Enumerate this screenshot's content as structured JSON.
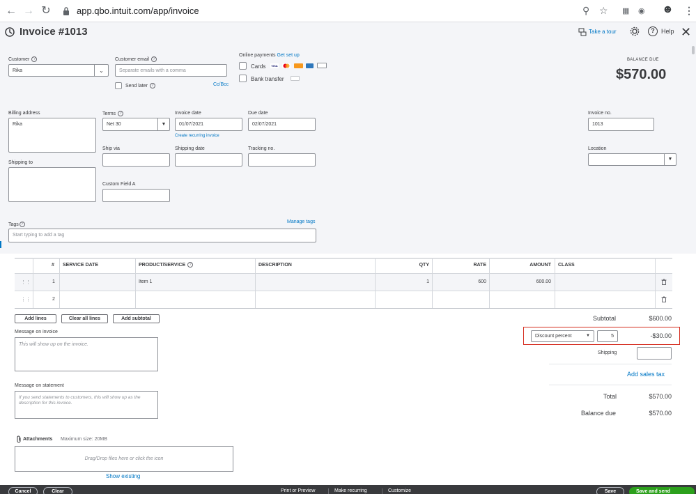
{
  "browser": {
    "url": "app.qbo.intuit.com/app/invoice"
  },
  "header": {
    "title": "Invoice #1013",
    "tour_label": "Take a tour",
    "help_label": "Help"
  },
  "customer": {
    "label": "Customer",
    "value": "Rika"
  },
  "customer_email": {
    "label": "Customer email",
    "placeholder": "Separate emails with a comma",
    "send_later_label": "Send later",
    "cc_bcc_label": "Cc/Bcc"
  },
  "online_payments": {
    "label": "Online payments",
    "get_set_up_label": "Get set up",
    "cards_label": "Cards",
    "bank_transfer_label": "Bank transfer"
  },
  "balance_due": {
    "label": "BALANCE DUE",
    "amount": "$570.00"
  },
  "billing_address": {
    "label": "Billing address",
    "value": "Rika"
  },
  "terms": {
    "label": "Terms",
    "value": "Net 30"
  },
  "invoice_date": {
    "label": "Invoice date",
    "value": "01/07/2021",
    "recurring_link": "Create recurring invoice"
  },
  "due_date": {
    "label": "Due date",
    "value": "02/07/2021"
  },
  "invoice_no": {
    "label": "Invoice no.",
    "value": "1013"
  },
  "ship_via": {
    "label": "Ship via"
  },
  "shipping_date": {
    "label": "Shipping date"
  },
  "tracking_no": {
    "label": "Tracking no."
  },
  "location": {
    "label": "Location"
  },
  "shipping_to": {
    "label": "Shipping to"
  },
  "custom_field_a": {
    "label": "Custom Field A"
  },
  "tags": {
    "label": "Tags",
    "manage_label": "Manage tags",
    "placeholder": "Start typing to add a tag"
  },
  "table": {
    "headers": {
      "num": "#",
      "service_date": "SERVICE DATE",
      "product": "PRODUCT/SERVICE",
      "description": "DESCRIPTION",
      "qty": "QTY",
      "rate": "RATE",
      "amount": "AMOUNT",
      "class": "CLASS"
    },
    "rows": [
      {
        "num": "1",
        "service_date": "",
        "product": "Item 1",
        "description": "",
        "qty": "1",
        "rate": "600",
        "amount": "600.00",
        "class": ""
      },
      {
        "num": "2",
        "service_date": "",
        "product": "",
        "description": "",
        "qty": "",
        "rate": "",
        "amount": "",
        "class": ""
      }
    ]
  },
  "line_buttons": {
    "add_lines": "Add lines",
    "clear_all_lines": "Clear all lines",
    "add_subtotal": "Add subtotal"
  },
  "message_invoice": {
    "label": "Message on invoice",
    "placeholder": "This will show up on the invoice."
  },
  "message_statement": {
    "label": "Message on statement",
    "placeholder": "If you send statements to customers, this will show up as the description for this invoice."
  },
  "attachments": {
    "label": "Attachments",
    "max_size": "Maximum size: 20MB",
    "drop_text": "Drag/Drop files here or click the icon",
    "show_existing": "Show existing"
  },
  "totals": {
    "subtotal_label": "Subtotal",
    "subtotal_value": "$600.00",
    "discount_type": "Discount percent",
    "discount_value": "5",
    "discount_amount": "-$30.00",
    "shipping_label": "Shipping",
    "add_sales_tax": "Add sales tax",
    "total_label": "Total",
    "total_value": "$570.00",
    "balance_due_label": "Balance due",
    "balance_due_value": "$570.00"
  },
  "footer": {
    "cancel": "Cancel",
    "clear": "Clear",
    "print_preview": "Print or Preview",
    "make_recurring": "Make recurring",
    "customize": "Customize",
    "save": "Save",
    "save_and_send": "Save and send"
  },
  "colors": {
    "accent": "#0077c5",
    "highlight_border": "#d52b1e",
    "primary_button": "#2ca01c",
    "footer_bg": "#393a3d"
  }
}
